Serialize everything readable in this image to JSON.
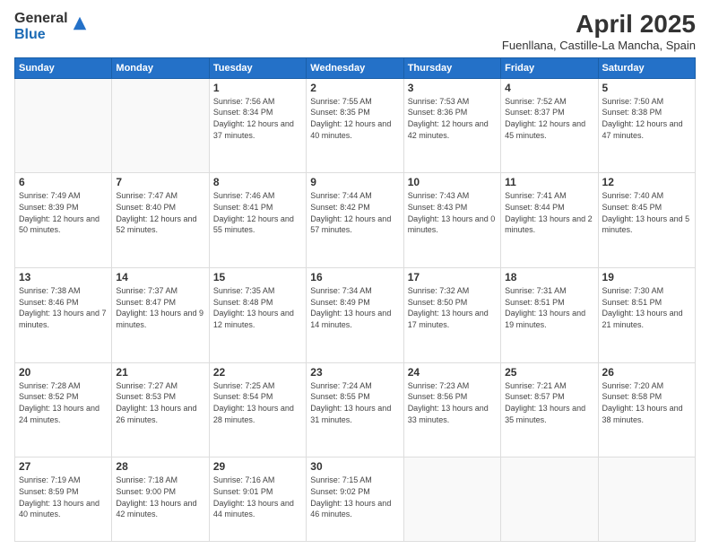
{
  "logo": {
    "general": "General",
    "blue": "Blue"
  },
  "title": "April 2025",
  "subtitle": "Fuenllana, Castille-La Mancha, Spain",
  "days_header": [
    "Sunday",
    "Monday",
    "Tuesday",
    "Wednesday",
    "Thursday",
    "Friday",
    "Saturday"
  ],
  "weeks": [
    [
      {
        "day": "",
        "info": ""
      },
      {
        "day": "",
        "info": ""
      },
      {
        "day": "1",
        "info": "Sunrise: 7:56 AM\nSunset: 8:34 PM\nDaylight: 12 hours and 37 minutes."
      },
      {
        "day": "2",
        "info": "Sunrise: 7:55 AM\nSunset: 8:35 PM\nDaylight: 12 hours and 40 minutes."
      },
      {
        "day": "3",
        "info": "Sunrise: 7:53 AM\nSunset: 8:36 PM\nDaylight: 12 hours and 42 minutes."
      },
      {
        "day": "4",
        "info": "Sunrise: 7:52 AM\nSunset: 8:37 PM\nDaylight: 12 hours and 45 minutes."
      },
      {
        "day": "5",
        "info": "Sunrise: 7:50 AM\nSunset: 8:38 PM\nDaylight: 12 hours and 47 minutes."
      }
    ],
    [
      {
        "day": "6",
        "info": "Sunrise: 7:49 AM\nSunset: 8:39 PM\nDaylight: 12 hours and 50 minutes."
      },
      {
        "day": "7",
        "info": "Sunrise: 7:47 AM\nSunset: 8:40 PM\nDaylight: 12 hours and 52 minutes."
      },
      {
        "day": "8",
        "info": "Sunrise: 7:46 AM\nSunset: 8:41 PM\nDaylight: 12 hours and 55 minutes."
      },
      {
        "day": "9",
        "info": "Sunrise: 7:44 AM\nSunset: 8:42 PM\nDaylight: 12 hours and 57 minutes."
      },
      {
        "day": "10",
        "info": "Sunrise: 7:43 AM\nSunset: 8:43 PM\nDaylight: 13 hours and 0 minutes."
      },
      {
        "day": "11",
        "info": "Sunrise: 7:41 AM\nSunset: 8:44 PM\nDaylight: 13 hours and 2 minutes."
      },
      {
        "day": "12",
        "info": "Sunrise: 7:40 AM\nSunset: 8:45 PM\nDaylight: 13 hours and 5 minutes."
      }
    ],
    [
      {
        "day": "13",
        "info": "Sunrise: 7:38 AM\nSunset: 8:46 PM\nDaylight: 13 hours and 7 minutes."
      },
      {
        "day": "14",
        "info": "Sunrise: 7:37 AM\nSunset: 8:47 PM\nDaylight: 13 hours and 9 minutes."
      },
      {
        "day": "15",
        "info": "Sunrise: 7:35 AM\nSunset: 8:48 PM\nDaylight: 13 hours and 12 minutes."
      },
      {
        "day": "16",
        "info": "Sunrise: 7:34 AM\nSunset: 8:49 PM\nDaylight: 13 hours and 14 minutes."
      },
      {
        "day": "17",
        "info": "Sunrise: 7:32 AM\nSunset: 8:50 PM\nDaylight: 13 hours and 17 minutes."
      },
      {
        "day": "18",
        "info": "Sunrise: 7:31 AM\nSunset: 8:51 PM\nDaylight: 13 hours and 19 minutes."
      },
      {
        "day": "19",
        "info": "Sunrise: 7:30 AM\nSunset: 8:51 PM\nDaylight: 13 hours and 21 minutes."
      }
    ],
    [
      {
        "day": "20",
        "info": "Sunrise: 7:28 AM\nSunset: 8:52 PM\nDaylight: 13 hours and 24 minutes."
      },
      {
        "day": "21",
        "info": "Sunrise: 7:27 AM\nSunset: 8:53 PM\nDaylight: 13 hours and 26 minutes."
      },
      {
        "day": "22",
        "info": "Sunrise: 7:25 AM\nSunset: 8:54 PM\nDaylight: 13 hours and 28 minutes."
      },
      {
        "day": "23",
        "info": "Sunrise: 7:24 AM\nSunset: 8:55 PM\nDaylight: 13 hours and 31 minutes."
      },
      {
        "day": "24",
        "info": "Sunrise: 7:23 AM\nSunset: 8:56 PM\nDaylight: 13 hours and 33 minutes."
      },
      {
        "day": "25",
        "info": "Sunrise: 7:21 AM\nSunset: 8:57 PM\nDaylight: 13 hours and 35 minutes."
      },
      {
        "day": "26",
        "info": "Sunrise: 7:20 AM\nSunset: 8:58 PM\nDaylight: 13 hours and 38 minutes."
      }
    ],
    [
      {
        "day": "27",
        "info": "Sunrise: 7:19 AM\nSunset: 8:59 PM\nDaylight: 13 hours and 40 minutes."
      },
      {
        "day": "28",
        "info": "Sunrise: 7:18 AM\nSunset: 9:00 PM\nDaylight: 13 hours and 42 minutes."
      },
      {
        "day": "29",
        "info": "Sunrise: 7:16 AM\nSunset: 9:01 PM\nDaylight: 13 hours and 44 minutes."
      },
      {
        "day": "30",
        "info": "Sunrise: 7:15 AM\nSunset: 9:02 PM\nDaylight: 13 hours and 46 minutes."
      },
      {
        "day": "",
        "info": ""
      },
      {
        "day": "",
        "info": ""
      },
      {
        "day": "",
        "info": ""
      }
    ]
  ]
}
